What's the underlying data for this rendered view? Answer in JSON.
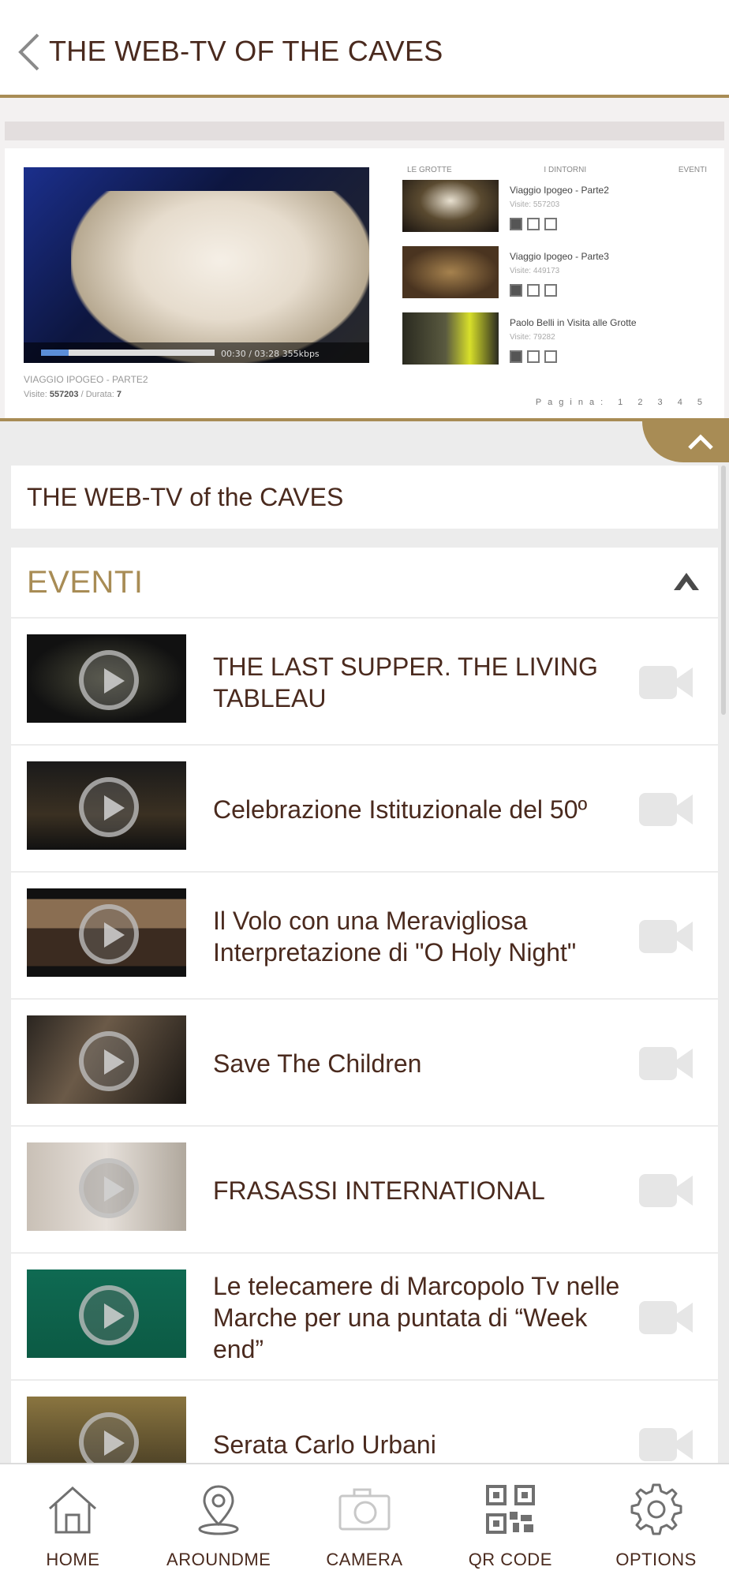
{
  "header": {
    "title": "THE WEB-TV OF THE CAVES"
  },
  "preview": {
    "tabs": [
      "LE GROTTE",
      "I DINTORNI",
      "EVENTI"
    ],
    "player": {
      "time": "00:30 / 03:28  355kbps"
    },
    "caption": "VIAGGIO IPOGEO - PARTE2",
    "caption_visits_label": "Visite:",
    "caption_visits": "557203",
    "caption_duration_label": "/ Durata:",
    "caption_duration": "7",
    "side_videos": [
      {
        "title": "Viaggio Ipogeo - Parte2",
        "visits": "Visite: 557203"
      },
      {
        "title": "Viaggio Ipogeo - Parte3",
        "visits": "Visite: 449173"
      },
      {
        "title": "Paolo Belli in Visita alle Grotte",
        "visits": "Visite: 79282"
      }
    ],
    "pager": "Pagina: 1 2 3 4 5"
  },
  "section_title": "THE WEB-TV of the CAVES",
  "category": {
    "label": "EVENTI",
    "expanded": true
  },
  "videos": [
    {
      "title": "THE LAST SUPPER. THE LIVING TABLEAU",
      "thumb_icon": "play-icon"
    },
    {
      "title": "Celebrazione Istituzionale del 50º",
      "thumb_icon": "play-icon"
    },
    {
      "title": "Il Volo con una Meravigliosa Interpretazione di \"O Holy Night\"",
      "thumb_icon": "play-icon"
    },
    {
      "title": "Save The Children",
      "thumb_icon": "play-icon"
    },
    {
      "title": "FRASASSI INTERNATIONAL",
      "thumb_icon": "play-icon"
    },
    {
      "title": "Le telecamere di Marcopolo Tv nelle Marche per una puntata di “Week end”",
      "thumb_icon": "play-icon"
    },
    {
      "title": "Serata Carlo Urbani",
      "thumb_icon": "play-icon"
    }
  ],
  "bottom_nav": [
    {
      "label": "HOME",
      "icon": "home-icon"
    },
    {
      "label": "AROUNDME",
      "icon": "location-pin-icon"
    },
    {
      "label": "CAMERA",
      "icon": "camera-icon"
    },
    {
      "label": "QR CODE",
      "icon": "qr-code-icon"
    },
    {
      "label": "OPTIONS",
      "icon": "gear-icon"
    }
  ],
  "colors": {
    "accent": "#a88c55",
    "text": "#4a2a1e",
    "background": "#ececec"
  }
}
